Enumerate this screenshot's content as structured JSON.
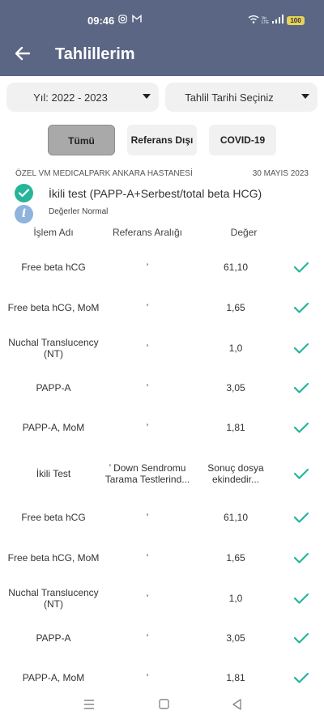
{
  "status_bar": {
    "time": "09:46",
    "battery": "100",
    "icons": [
      "instagram-icon",
      "gmail-icon",
      "wifi-icon",
      "volte-icon",
      "signal-icon",
      "battery-icon"
    ]
  },
  "app_bar": {
    "title": "Tahlillerim",
    "back_icon": "arrow-left-icon"
  },
  "filters": {
    "year": {
      "label": "Yıl: 2022 - 2023"
    },
    "date": {
      "label": "Tahlil Tarihi Seçiniz"
    }
  },
  "tabs": [
    {
      "label": "Tümü",
      "active": true
    },
    {
      "label": "Referans Dışı",
      "active": false
    },
    {
      "label": "COVID-19",
      "active": false
    }
  ],
  "report": {
    "hospital": "ÖZEL VM MEDICALPARK ANKARA HASTANESİ",
    "date": "30 MAYIS 2023",
    "test_name": "İkili test (PAPP-A+Serbest/total beta HCG)",
    "note": "Değerler Normal"
  },
  "table": {
    "headers": {
      "name": "İşlem Adı",
      "reference": "Referans Aralığı",
      "value": "Değer"
    },
    "rows": [
      {
        "name": "Free beta hCG",
        "reference": "’",
        "value": "61,10",
        "status": "normal"
      },
      {
        "name": "Free beta hCG, MoM",
        "reference": "’",
        "value": "1,65",
        "status": "normal"
      },
      {
        "name": "Nuchal Translucency (NT)",
        "reference": "’",
        "value": "1,0",
        "status": "normal"
      },
      {
        "name": "PAPP-A",
        "reference": "’",
        "value": "3,05",
        "status": "normal"
      },
      {
        "name": "PAPP-A, MoM",
        "reference": "’",
        "value": "1,81",
        "status": "normal"
      },
      {
        "name": "İkili Test",
        "reference": "’ Down Sendromu Tarama Testlerind...",
        "value": "Sonuç dosya ekindedir...",
        "status": "normal"
      },
      {
        "name": "Free beta hCG",
        "reference": "’",
        "value": "61,10",
        "status": "normal"
      },
      {
        "name": "Free beta hCG, MoM",
        "reference": "’",
        "value": "1,65",
        "status": "normal"
      },
      {
        "name": "Nuchal Translucency (NT)",
        "reference": "’",
        "value": "1,0",
        "status": "normal"
      },
      {
        "name": "PAPP-A",
        "reference": "’",
        "value": "3,05",
        "status": "normal"
      },
      {
        "name": "PAPP-A, MoM",
        "reference": "’",
        "value": "1,81",
        "status": "normal"
      }
    ]
  },
  "nav_bar": {
    "icons": [
      "menu-icon",
      "home-square-icon",
      "back-triangle-icon"
    ]
  },
  "colors": {
    "header_bg": "#5a6683",
    "accent_green": "#26b59a",
    "info_blue": "#8fb3dc",
    "tab_active": "#a9a9a9",
    "chip_bg": "#f1f1f1"
  }
}
